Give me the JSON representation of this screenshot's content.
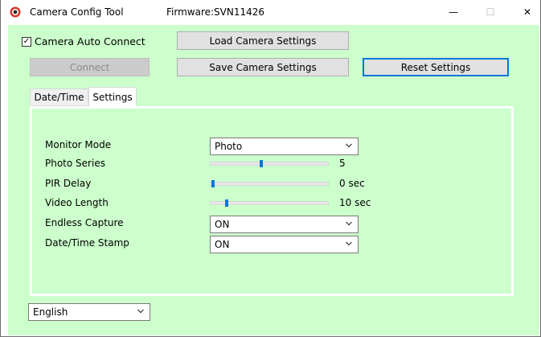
{
  "window": {
    "title": "Camera Config Tool",
    "firmware": "Firmware:SVN11426",
    "controls": {
      "minimize": "—",
      "maximize": "☐",
      "close": "✕"
    }
  },
  "top": {
    "auto_connect_label": "Camera Auto Connect",
    "auto_connect_checked": "✓",
    "connect_label": "Connect",
    "load_label": "Load Camera Settings",
    "save_label": "Save Camera Settings",
    "reset_label": "Reset Settings"
  },
  "tabs": [
    {
      "label": "Date/Time"
    },
    {
      "label": "Settings"
    }
  ],
  "settings": {
    "monitor_mode": {
      "label": "Monitor Mode",
      "value": "Photo"
    },
    "photo_series": {
      "label": "Photo Series",
      "value": "5",
      "level": 0.43
    },
    "pir_delay": {
      "label": "PIR Delay",
      "value": "0 sec",
      "level": 0.0
    },
    "video_length": {
      "label": "Video Length",
      "value": "10 sec",
      "level": 0.12
    },
    "endless_capture": {
      "label": "Endless Capture",
      "value": "ON"
    },
    "datetime_stamp": {
      "label": "Date/Time Stamp",
      "value": "ON"
    }
  },
  "language": {
    "value": "English"
  },
  "icons": {
    "app": "camera-app-icon",
    "dropdown": "chevron-down-icon"
  },
  "colors": {
    "client_bg": "#ccffcc",
    "accent": "#0078d7"
  }
}
